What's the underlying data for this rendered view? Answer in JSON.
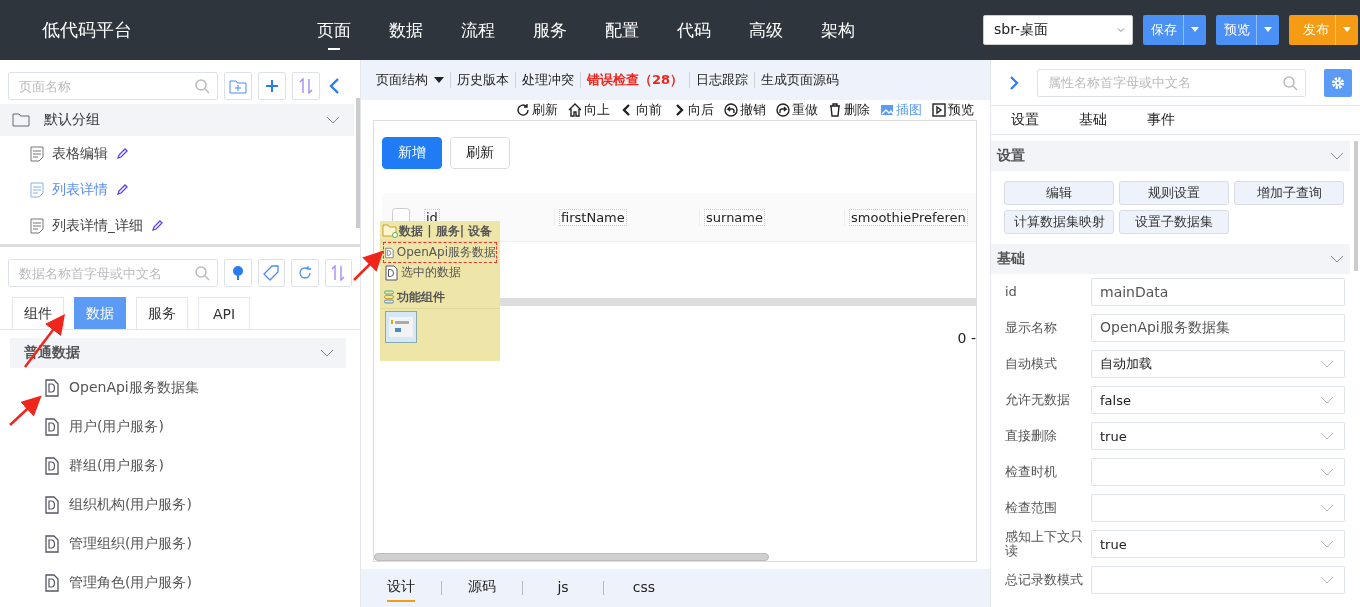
{
  "app": {
    "title": "低代码平台"
  },
  "nav": [
    {
      "label": "页面",
      "selected": true
    },
    {
      "label": "数据",
      "selected": false
    },
    {
      "label": "流程",
      "selected": false
    },
    {
      "label": "服务",
      "selected": false
    },
    {
      "label": "配置",
      "selected": false
    },
    {
      "label": "代码",
      "selected": false
    },
    {
      "label": "高级",
      "selected": false
    },
    {
      "label": "架构",
      "selected": false
    }
  ],
  "workspace_select": {
    "value": "sbr-桌面"
  },
  "header_buttons": [
    {
      "label": "保存",
      "kind": "primary"
    },
    {
      "label": "预览",
      "kind": "primary"
    },
    {
      "label": "发布",
      "kind": "accent"
    }
  ],
  "pages_panel": {
    "search": {
      "placeholder": "页面名称"
    },
    "group": {
      "label": "默认分组",
      "expanded": true,
      "items": [
        {
          "label": "表格编辑",
          "selected": false
        },
        {
          "label": "列表详情",
          "selected": true
        },
        {
          "label": "列表详情_详细",
          "selected": false
        }
      ]
    }
  },
  "data_panel": {
    "search": {
      "placeholder": "数据名称首字母或中文名"
    },
    "tabs": [
      {
        "label": "组件",
        "selected": false
      },
      {
        "label": "数据",
        "selected": true
      },
      {
        "label": "服务",
        "selected": false
      },
      {
        "label": "API",
        "selected": false
      }
    ],
    "section": {
      "label": "普通数据",
      "expanded": true,
      "items": [
        "OpenApi服务数据集",
        "用户(用户服务)",
        "群组(用户服务)",
        "组织机构(用户服务)",
        "管理组织(用户服务)",
        "管理角色(用户服务)"
      ]
    }
  },
  "toolbar": [
    {
      "label": "页面结构",
      "kind": "dropdown"
    },
    {
      "label": "历史版本",
      "kind": "plain"
    },
    {
      "label": "处理冲突",
      "kind": "plain"
    },
    {
      "label": "错误检查（28）",
      "kind": "error"
    },
    {
      "label": "日志跟踪",
      "kind": "plain"
    },
    {
      "label": "生成页面源码",
      "kind": "plain"
    }
  ],
  "actions": [
    {
      "label": "刷新",
      "active": false
    },
    {
      "label": "向上",
      "active": false
    },
    {
      "label": "向前",
      "active": false
    },
    {
      "label": "向后",
      "active": false
    },
    {
      "label": "撤销",
      "active": false
    },
    {
      "label": "重做",
      "active": false
    },
    {
      "label": "删除",
      "active": false
    },
    {
      "label": "插图",
      "active": true
    },
    {
      "label": "预览",
      "active": false
    }
  ],
  "canvas": {
    "buttons": [
      {
        "label": "新增",
        "kind": "primary"
      },
      {
        "label": "刷新",
        "kind": "default"
      }
    ],
    "table": {
      "select_all": {
        "checked": false
      },
      "columns": [
        "id",
        "firstName",
        "surname",
        "smoothiePreferen"
      ]
    },
    "pager": "0 -"
  },
  "popup": {
    "title": "数据 | 服务| 设备",
    "items": [
      {
        "label": "OpenApi服务数据",
        "selected": true
      },
      {
        "label": "选中的数据",
        "selected": false
      }
    ],
    "section": "功能组件"
  },
  "bottom_tabs": [
    {
      "label": "设计",
      "selected": true
    },
    {
      "label": "源码",
      "selected": false
    },
    {
      "label": "js",
      "selected": false
    },
    {
      "label": "css",
      "selected": false
    }
  ],
  "inspector": {
    "search": {
      "placeholder": "属性名称首字母或中文名"
    },
    "tabs": [
      "设置",
      "基础",
      "事件"
    ],
    "settings": {
      "label": "设置",
      "expanded": true,
      "buttons": [
        "编辑",
        "规则设置",
        "增加子查询",
        "计算数据集映射",
        "设置子数据集"
      ]
    },
    "basics": {
      "label": "基础",
      "expanded": true,
      "rows": [
        {
          "label": "id",
          "kind": "text",
          "value": "mainData"
        },
        {
          "label": "显示名称",
          "kind": "text",
          "value": "OpenApi服务数据集"
        },
        {
          "label": "自动模式",
          "kind": "select",
          "value": "自动加载"
        },
        {
          "label": "允许无数据",
          "kind": "select",
          "value": "false"
        },
        {
          "label": "直接删除",
          "kind": "select",
          "value": "true"
        },
        {
          "label": "检查时机",
          "kind": "select"
        },
        {
          "label": "检查范围",
          "kind": "select"
        },
        {
          "label": "感知上下文只读",
          "kind": "select",
          "value": "true"
        },
        {
          "label": "总记录数模式",
          "kind": "select"
        }
      ]
    }
  }
}
